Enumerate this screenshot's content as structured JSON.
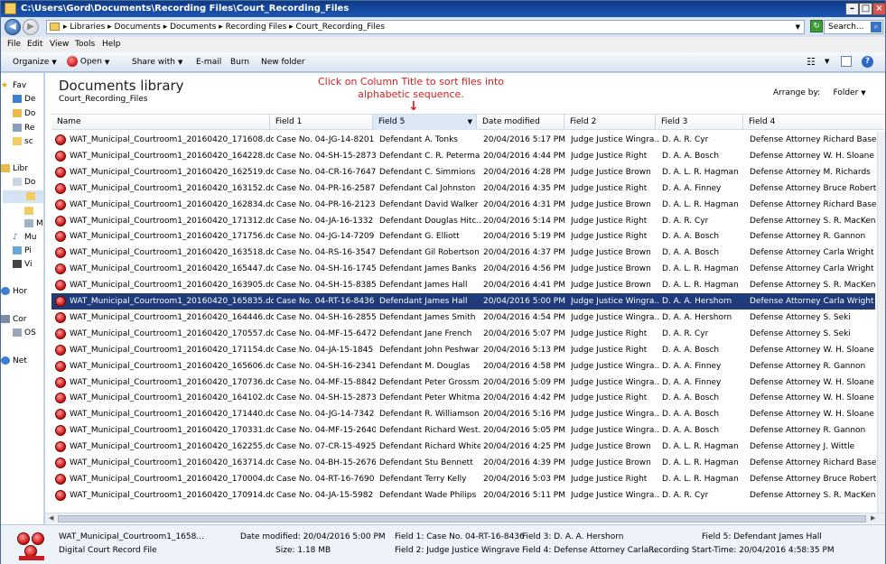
{
  "window": {
    "title": "C:\\Users\\Gord\\Documents\\Recording Files\\Court_Recording_Files"
  },
  "address": {
    "crumbs": [
      "Libraries",
      "Documents",
      "Documents",
      "Recording Files",
      "Court_Recording_Files"
    ],
    "search_placeholder": "Search..."
  },
  "menu": [
    "File",
    "Edit",
    "View",
    "Tools",
    "Help"
  ],
  "toolbar": {
    "organize": "Organize",
    "open": "Open",
    "share": "Share with",
    "email": "E-mail",
    "burn": "Burn",
    "new_folder": "New folder"
  },
  "nav": [
    "Fav",
    "De",
    "Do",
    "Re",
    "sc",
    "Libr",
    "Do",
    "",
    "Mi",
    "Mu",
    "Pi",
    "Vi",
    "Hor",
    "Cor",
    "OS",
    "Net"
  ],
  "library": {
    "title": "Documents library",
    "subtitle": "Court_Recording_Files",
    "arrange_label": "Arrange by:",
    "arrange_value": "Folder"
  },
  "annotation": {
    "text": "Click on Column Title to sort files into alphabetic sequence.",
    "arrow": "↓"
  },
  "columns": [
    "Name",
    "Field 1",
    "Field 5",
    "Date modified",
    "Field 2",
    "Field 3",
    "Field 4"
  ],
  "rows": [
    [
      "WAT_Municipal_Courtroom1_20160420_171608.dcr",
      "Case No. 04-JG-14-8201",
      "Defendant A. Tonks",
      "20/04/2016 5:17 PM",
      "Judge Justice Wingra...",
      "D. A. R. Cyr",
      "Defense Attorney Richard Basehart"
    ],
    [
      "WAT_Municipal_Courtroom1_20160420_164228.dcr",
      "Case No. 04-SH-15-2873",
      "Defendant C. R. Peterman",
      "20/04/2016 4:44 PM",
      "Judge Justice Right",
      "D. A. A. Bosch",
      "Defense Attorney W. H. Sloane"
    ],
    [
      "WAT_Municipal_Courtroom1_20160420_162519.dcr",
      "Case No. 04-CR-16-7647",
      "Defendant C. Simmions",
      "20/04/2016 4:28 PM",
      "Judge Justice Brown",
      "D. A. L. R. Hagman",
      "Defense Attorney M. Richards"
    ],
    [
      "WAT_Municipal_Courtroom1_20160420_163152.dcr",
      "Case No. 04-PR-16-2587",
      "Defendant Cal Johnston",
      "20/04/2016 4:35 PM",
      "Judge Justice Right",
      "D. A. A. Finney",
      "Defense Attorney Bruce Robertson"
    ],
    [
      "WAT_Municipal_Courtroom1_20160420_162834.dcr",
      "Case No. 04-PR-16-2123",
      "Defendant David Walker",
      "20/04/2016 4:31 PM",
      "Judge Justice Brown",
      "D. A. L. R. Hagman",
      "Defense Attorney Richard Basehart"
    ],
    [
      "WAT_Municipal_Courtroom1_20160420_171312.dcr",
      "Case No. 04-JA-16-1332",
      "Defendant Douglas Hitc...",
      "20/04/2016 5:14 PM",
      "Judge Justice Right",
      "D. A. R. Cyr",
      "Defense Attorney S. R. MacKenzie"
    ],
    [
      "WAT_Municipal_Courtroom1_20160420_171756.dcr",
      "Case No. 04-JG-14-7209",
      "Defendant G. Elliott",
      "20/04/2016 5:19 PM",
      "Judge Justice Right",
      "D. A. A. Bosch",
      "Defense Attorney R. Gannon"
    ],
    [
      "WAT_Municipal_Courtroom1_20160420_163518.dcr",
      "Case No. 04-RS-16-3547",
      "Defendant Gil Robertson",
      "20/04/2016 4:37 PM",
      "Judge Justice Brown",
      "D. A. A. Bosch",
      "Defense Attorney Carla Wright"
    ],
    [
      "WAT_Municipal_Courtroom1_20160420_165447.dcr",
      "Case No. 04-SH-16-1745",
      "Defendant James Banks",
      "20/04/2016 4:56 PM",
      "Judge Justice Brown",
      "D. A. L. R. Hagman",
      "Defense Attorney Carla Wright"
    ],
    [
      "WAT_Municipal_Courtroom1_20160420_163905.dcr",
      "Case No. 04-SH-15-8385",
      "Defendant James Hall",
      "20/04/2016 4:41 PM",
      "Judge Justice Brown",
      "D. A. L. R. Hagman",
      "Defense Attorney S. R. MacKenzie"
    ],
    [
      "WAT_Municipal_Courtroom1_20160420_165835.dcr",
      "Case No. 04-RT-16-8436",
      "Defendant James Hall",
      "20/04/2016 5:00 PM",
      "Judge Justice Wingra...",
      "D. A. A. Hershorn",
      "Defense Attorney Carla Wright"
    ],
    [
      "WAT_Municipal_Courtroom1_20160420_164446.dcr",
      "Case No. 04-SH-16-2855",
      "Defendant James Smith",
      "20/04/2016 4:54 PM",
      "Judge Justice Wingra...",
      "D. A. A. Hershorn",
      "Defense Attorney S. Seki"
    ],
    [
      "WAT_Municipal_Courtroom1_20160420_170557.dcr",
      "Case No. 04-MF-15-6472",
      "Defendant Jane French",
      "20/04/2016 5:07 PM",
      "Judge Justice Right",
      "D. A. R. Cyr",
      "Defense Attorney S. Seki"
    ],
    [
      "WAT_Municipal_Courtroom1_20160420_171154.dcr",
      "Case No. 04-JA-15-1845",
      "Defendant John Peshwar",
      "20/04/2016 5:13 PM",
      "Judge Justice Right",
      "D. A. A. Bosch",
      "Defense Attorney W. H. Sloane"
    ],
    [
      "WAT_Municipal_Courtroom1_20160420_165606.dcr",
      "Case No. 04-SH-16-2341",
      "Defendant M. Douglas",
      "20/04/2016 4:58 PM",
      "Judge Justice Wingra...",
      "D. A. A. Finney",
      "Defense Attorney R. Gannon"
    ],
    [
      "WAT_Municipal_Courtroom1_20160420_170736.dcr",
      "Case No. 04-MF-15-8842",
      "Defendant Peter Grossm...",
      "20/04/2016 5:09 PM",
      "Judge Justice Wingra...",
      "D. A. A. Finney",
      "Defense Attorney W. H. Sloane"
    ],
    [
      "WAT_Municipal_Courtroom1_20160420_164102.dcr",
      "Case No. 04-SH-15-2873",
      "Defendant Peter Whitman",
      "20/04/2016 4:42 PM",
      "Judge Justice Right",
      "D. A. A. Bosch",
      "Defense Attorney W. H. Sloane"
    ],
    [
      "WAT_Municipal_Courtroom1_20160420_171440.dcr",
      "Case No. 04-JG-14-7342",
      "Defendant R. Williamson",
      "20/04/2016 5:16 PM",
      "Judge Justice Wingra...",
      "D. A. A. Bosch",
      "Defense Attorney W. H. Sloane"
    ],
    [
      "WAT_Municipal_Courtroom1_20160420_170331.dcr",
      "Case No. 04-MF-15-2640",
      "Defendant Richard West...",
      "20/04/2016 5:05 PM",
      "Judge Justice Wingra...",
      "D. A. A. Bosch",
      "Defense Attorney R. Gannon"
    ],
    [
      "WAT_Municipal_Courtroom1_20160420_162255.dcr",
      "Case No. 07-CR-15-4925",
      "Defendant Richard White",
      "20/04/2016 4:25 PM",
      "Judge Justice Brown",
      "D. A. L. R. Hagman",
      "Defense Attorney J. Wittle"
    ],
    [
      "WAT_Municipal_Courtroom1_20160420_163714.dcr",
      "Case No. 04-BH-15-2676",
      "Defendant Stu Bennett",
      "20/04/2016 4:39 PM",
      "Judge Justice Brown",
      "D. A. L. R. Hagman",
      "Defense Attorney Richard Basehart"
    ],
    [
      "WAT_Municipal_Courtroom1_20160420_170004.dcr",
      "Case No. 04-RT-16-7690",
      "Defendant Terry Kelly",
      "20/04/2016 5:03 PM",
      "Judge Justice Right",
      "D. A. L. R. Hagman",
      "Defense Attorney Bruce Robertson"
    ],
    [
      "WAT_Municipal_Courtroom1_20160420_170914.dcr",
      "Case No. 04-JA-15-5982",
      "Defendant Wade Philips",
      "20/04/2016 5:11 PM",
      "Judge Justice Wingra...",
      "D. A. R. Cyr",
      "Defense Attorney S. R. MacKenzie"
    ]
  ],
  "selected_row": 10,
  "details": {
    "name": "WAT_Municipal_Courtroom1_1658...",
    "type": "Digital Court Record File",
    "date_modified": "Date modified: 20/04/2016 5:00 PM",
    "size": "Size: 1.18 MB",
    "field1": "Field 1: Case No. 04-RT-16-8436",
    "field2": "Field 2: Judge Justice Wingrave",
    "field3": "Field 3: D. A. A. Hershorn",
    "field4": "Field 4: Defense Attorney Carla ...",
    "field5": "Field 5: Defendant James Hall",
    "recording_start": "Recording Start-Time: 20/04/2016 4:58:35 PM"
  }
}
